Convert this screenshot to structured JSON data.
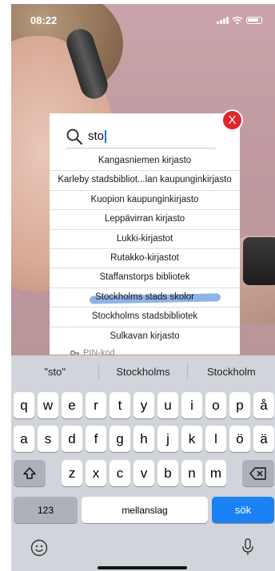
{
  "status_bar": {
    "time": "08:22"
  },
  "search": {
    "query": "sto"
  },
  "close_label": "X",
  "results": [
    "Kangasniemen kirjasto",
    "Karleby stadsbibliot...lan kaupunginkirjasto",
    "Kuopion kaupunginkirjasto",
    "Leppävirran kirjasto",
    "Lukki-kirjastot",
    "Rutakko-kirjastot",
    "Staffanstorps bibliotek",
    "Stockholms stads skolor",
    "Stockholms stadsbibliotek",
    "Sulkavan kirjasto"
  ],
  "pin_hint": "PIN-kod",
  "keyboard": {
    "suggestions": [
      "\"sto\"",
      "Stockholms",
      "Stockholm"
    ],
    "row1": [
      "q",
      "w",
      "e",
      "r",
      "t",
      "y",
      "u",
      "i",
      "o",
      "p",
      "å"
    ],
    "row2": [
      "a",
      "s",
      "d",
      "f",
      "g",
      "h",
      "j",
      "k",
      "l",
      "ö",
      "ä"
    ],
    "row3": [
      "z",
      "x",
      "c",
      "v",
      "b",
      "n",
      "m"
    ],
    "numbers_label": "123",
    "space_label": "mellanslag",
    "search_label": "sök"
  },
  "colors": {
    "accent": "#1a82f5",
    "close": "#e0262b",
    "highlight": "#7ba6e0"
  }
}
